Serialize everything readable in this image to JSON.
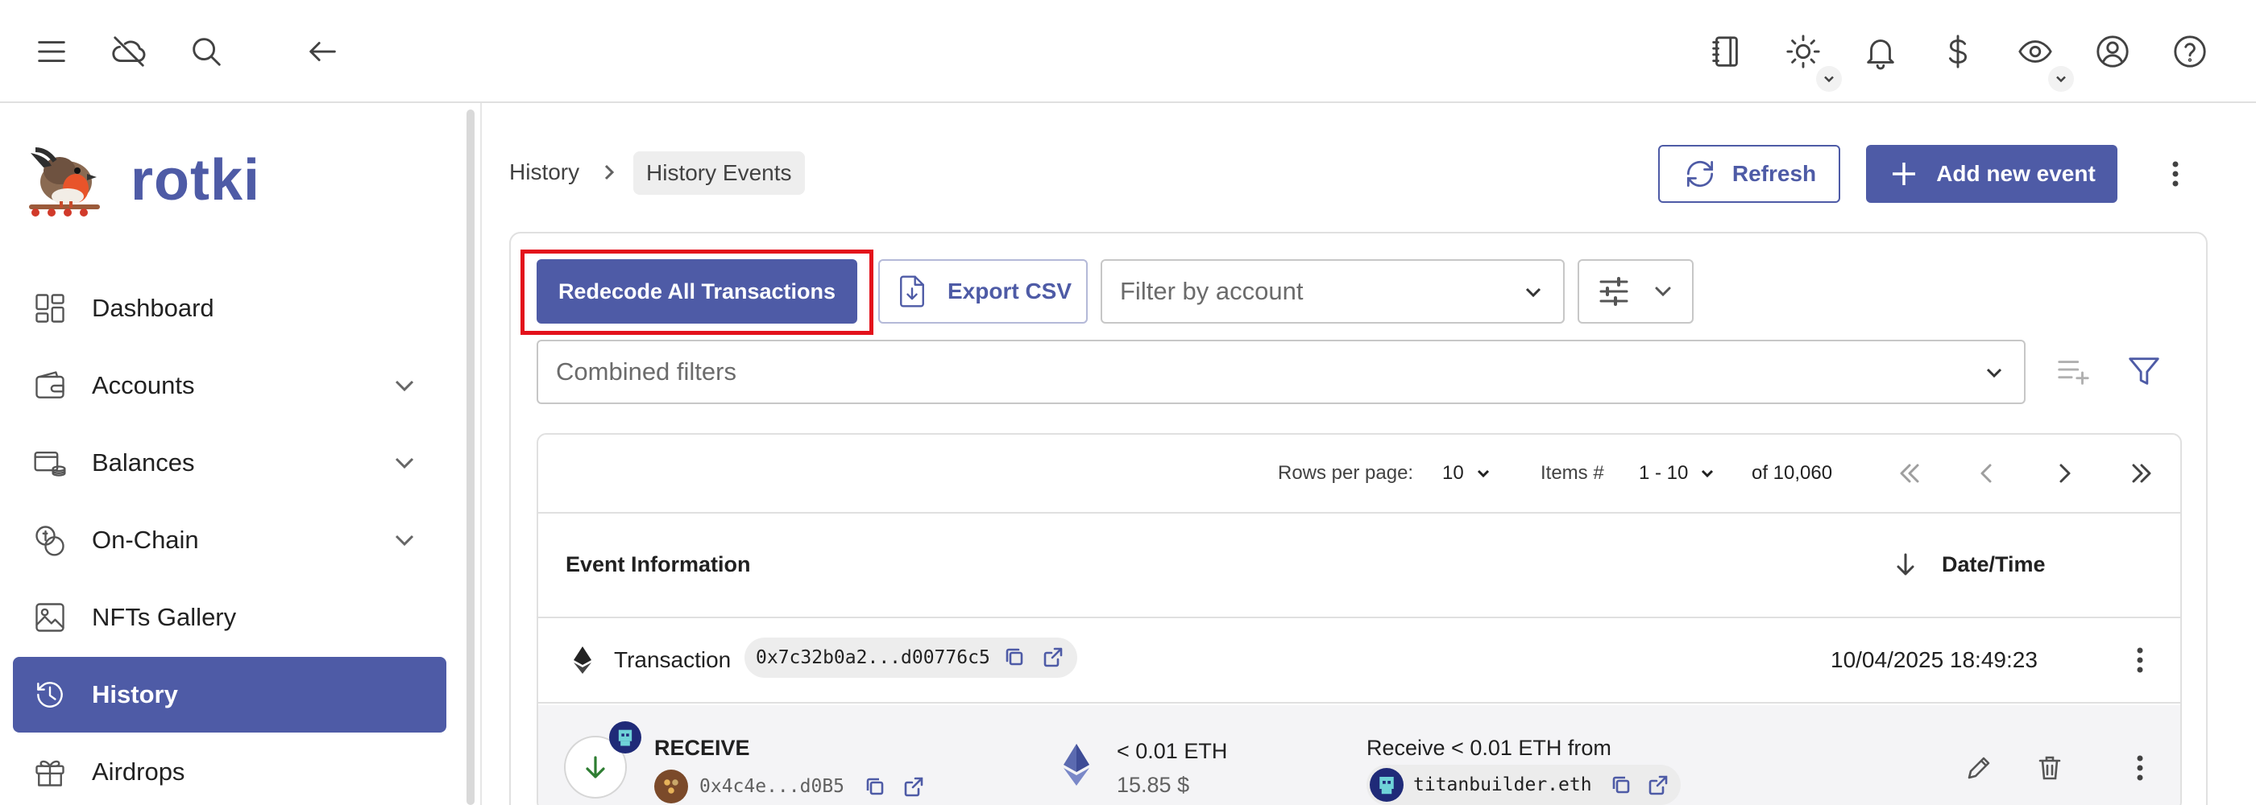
{
  "app": {
    "name": "rotki"
  },
  "sidebar": {
    "items": [
      {
        "label": "Dashboard",
        "icon": "dashboard-icon",
        "expandable": false,
        "active": false
      },
      {
        "label": "Accounts",
        "icon": "wallet-icon",
        "expandable": true,
        "active": false
      },
      {
        "label": "Balances",
        "icon": "balances-icon",
        "expandable": true,
        "active": false
      },
      {
        "label": "On-Chain",
        "icon": "coins-icon",
        "expandable": true,
        "active": false
      },
      {
        "label": "NFTs Gallery",
        "icon": "image-icon",
        "expandable": false,
        "active": false
      },
      {
        "label": "History",
        "icon": "history-icon",
        "expandable": false,
        "active": true
      },
      {
        "label": "Airdrops",
        "icon": "gift-icon",
        "expandable": false,
        "active": false
      }
    ]
  },
  "topbar": {
    "left_icons": [
      "menu-icon",
      "cloud-off-icon",
      "search-icon",
      "back-arrow-icon"
    ],
    "right_icons": [
      "notes-icon",
      "theme-sun-icon",
      "bell-icon",
      "dollar-icon",
      "eye-icon",
      "account-circle-icon",
      "help-icon"
    ]
  },
  "breadcrumb": {
    "root": "History",
    "current": "History Events"
  },
  "actions": {
    "refresh": "Refresh",
    "add": "Add new event"
  },
  "toolbar": {
    "redecode": "Redecode All Transactions",
    "export": "Export CSV",
    "account_filter_placeholder": "Filter by account",
    "combined_filters_placeholder": "Combined filters"
  },
  "pagination": {
    "rows_label": "Rows per page:",
    "rows_value": "10",
    "items_label": "Items #",
    "items_value": "1 - 10",
    "total": "of 10,060"
  },
  "table": {
    "col_event": "Event Information",
    "col_date": "Date/Time",
    "transaction": {
      "label": "Transaction",
      "hash": "0x7c32b0a2...d00776c5",
      "datetime": "10/04/2025 18:49:23"
    },
    "event": {
      "type": "RECEIVE",
      "address": "0x4c4e...d0B5",
      "amount": "< 0.01 ETH",
      "value": "15.85 $",
      "description": "Receive < 0.01 ETH from",
      "counterparty": "titanbuilder.eth"
    }
  },
  "colors": {
    "primary": "#4e5ba6",
    "highlight_box": "#e3111b"
  }
}
